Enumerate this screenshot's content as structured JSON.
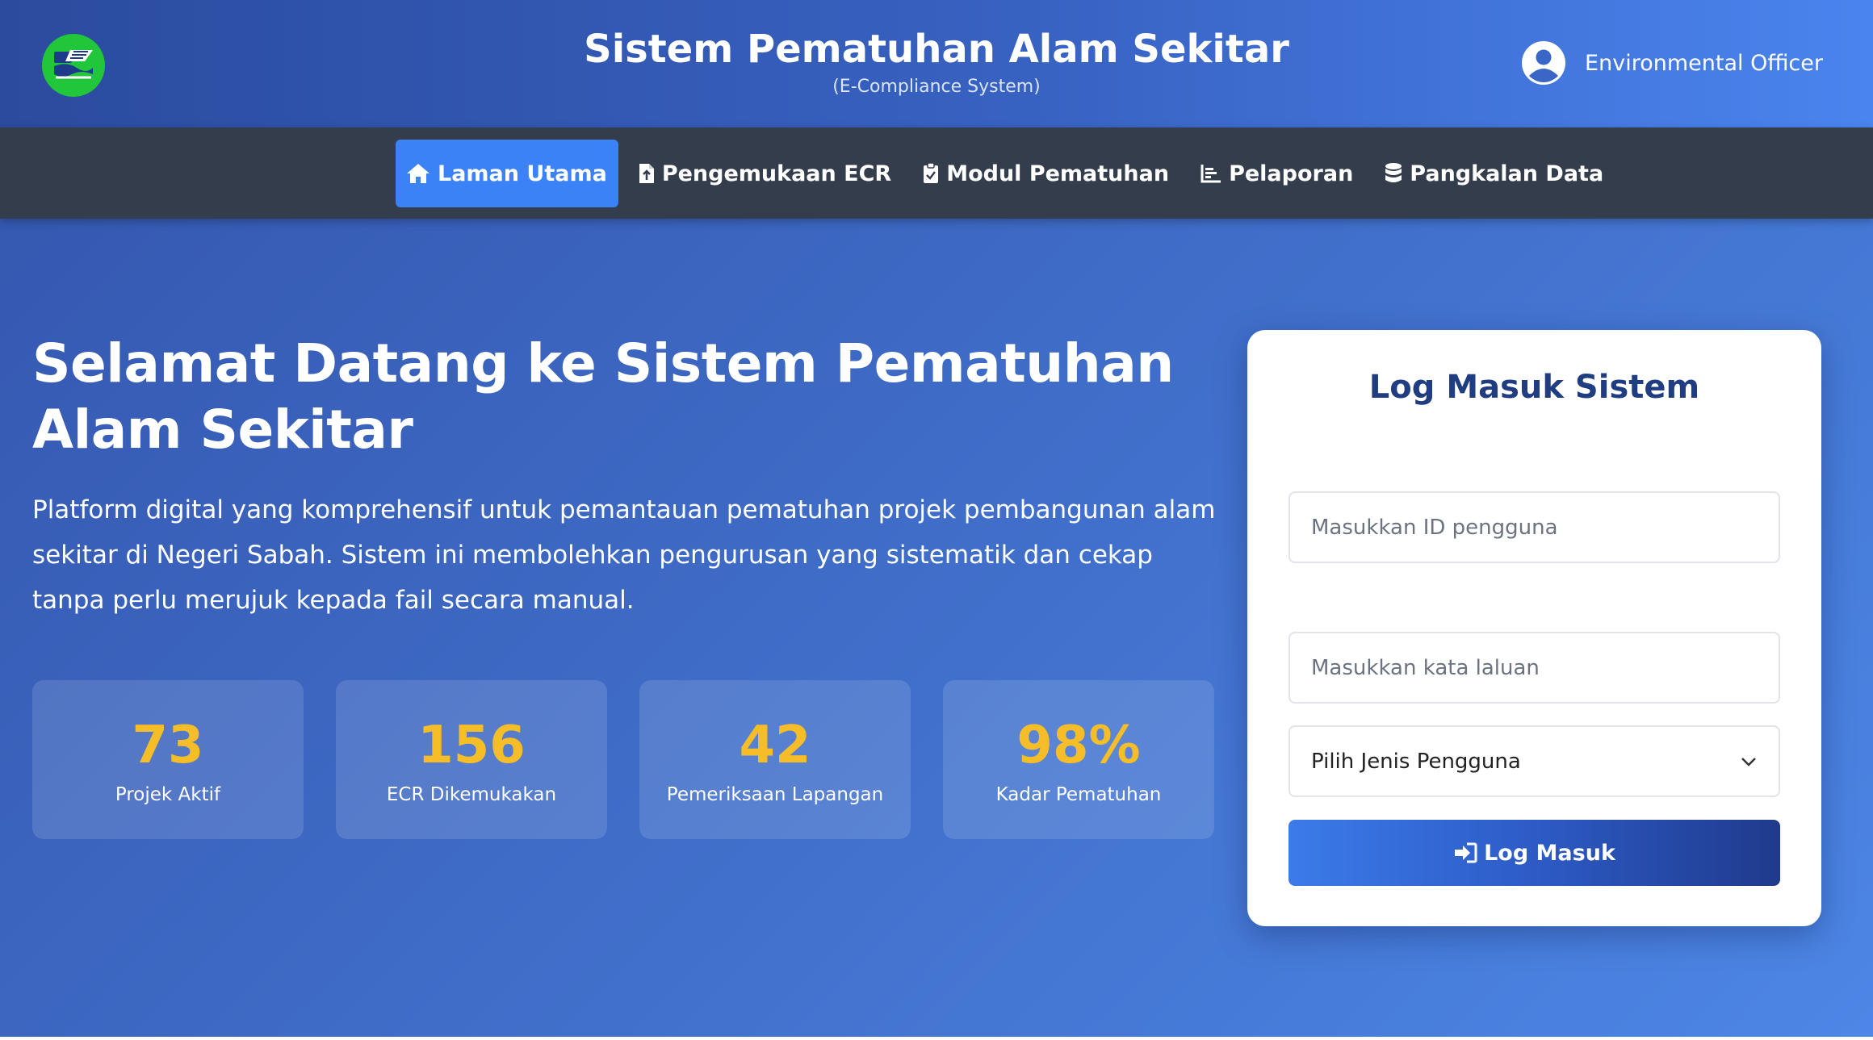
{
  "header": {
    "title": "Sistem Pematuhan Alam Sekitar",
    "subtitle": "(E-Compliance System)",
    "user_name": "Environmental Officer"
  },
  "nav": {
    "items": [
      {
        "label": "Laman Utama",
        "icon": "home-icon",
        "active": true
      },
      {
        "label": "Pengemukaan ECR",
        "icon": "file-upload-icon",
        "active": false
      },
      {
        "label": "Modul Pematuhan",
        "icon": "clipboard-check-icon",
        "active": false
      },
      {
        "label": "Pelaporan",
        "icon": "bar-chart-icon",
        "active": false
      },
      {
        "label": "Pangkalan Data",
        "icon": "database-icon",
        "active": false
      }
    ]
  },
  "hero": {
    "title": "Selamat Datang ke Sistem Pematuhan Alam Sekitar",
    "description": "Platform digital yang komprehensif untuk pemantauan pematuhan projek pembangunan alam sekitar di Negeri Sabah. Sistem ini membolehkan pengurusan yang sistematik dan cekap tanpa perlu merujuk kepada fail secara manual."
  },
  "stats": [
    {
      "value": "73",
      "label": "Projek Aktif"
    },
    {
      "value": "156",
      "label": "ECR Dikemukakan"
    },
    {
      "value": "42",
      "label": "Pemeriksaan Lapangan"
    },
    {
      "value": "98%",
      "label": "Kadar Pematuhan"
    }
  ],
  "login": {
    "title": "Log Masuk Sistem",
    "user_placeholder": "Masukkan ID pengguna",
    "user_value": "",
    "password_placeholder": "Masukkan kata laluan",
    "password_value": "",
    "user_type_selected": "Pilih Jenis Pengguna",
    "button_label": "Log Masuk"
  },
  "colors": {
    "accent": "#3b82f6",
    "nav_bg": "#343d4b",
    "stat_value": "#f5bd28",
    "card_title": "#1f3d80",
    "logo_green": "#22c63a"
  }
}
